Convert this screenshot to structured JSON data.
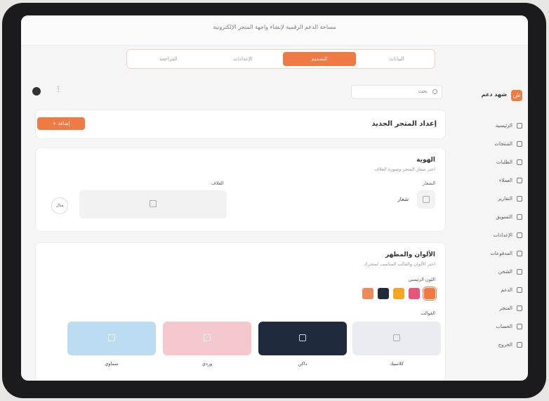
{
  "banner": {
    "text": "مساحة الدعم الرقمية لإنشاء واجهة المتجر الإلكترونية"
  },
  "steps": [
    {
      "label": "البيانات"
    },
    {
      "label": "التصميم"
    },
    {
      "label": "الإعدادات"
    },
    {
      "label": "المراجعة"
    }
  ],
  "sidebar": {
    "brand": "شهد دعم",
    "brand_icon": "ش",
    "items": [
      {
        "label": "الرئيسية",
        "icon": "home-icon"
      },
      {
        "label": "المنتجات",
        "icon": "box-icon"
      },
      {
        "label": "الطلبات",
        "icon": "cart-icon"
      },
      {
        "label": "العملاء",
        "icon": "users-icon"
      },
      {
        "label": "التقارير",
        "icon": "chart-icon"
      },
      {
        "label": "التسويق",
        "icon": "megaphone-icon"
      },
      {
        "label": "الإعدادات",
        "icon": "gear-icon"
      },
      {
        "label": "المدفوعات",
        "icon": "card-icon"
      },
      {
        "label": "الشحن",
        "icon": "truck-icon"
      },
      {
        "label": "الدعم",
        "icon": "help-icon"
      },
      {
        "label": "المتجر",
        "icon": "store-icon"
      },
      {
        "label": "الحساب",
        "icon": "user-icon"
      },
      {
        "label": "الخروج",
        "icon": "logout-icon"
      }
    ]
  },
  "topbar": {
    "search_label": "بحث",
    "more": "⋮"
  },
  "header_card": {
    "title": "إعداد المتجر الجديد",
    "button": "+ إضافة"
  },
  "identity": {
    "title": "الهوية",
    "subtitle": "اختر شعار المتجر وصورة الغلاف",
    "logo_label": "الشعار",
    "logo_name": "شعار",
    "cover_label": "الغلاف",
    "example": "مثال"
  },
  "colors": {
    "title": "الألوان والمظهر",
    "subtitle": "اختر الألوان والقالب المناسب لمتجرك",
    "palette_label": "اللون الرئيسي",
    "swatches": [
      "#f07a43",
      "#e8547a",
      "#f4a623",
      "#1f2b3d",
      "#e88c5c"
    ],
    "themes_label": "القوالب",
    "themes": [
      {
        "name": "كلاسيك",
        "color": "#e9edf2"
      },
      {
        "name": "داكن",
        "color": "#1f2b3d"
      },
      {
        "name": "وردي",
        "color": "#f5c8cf"
      },
      {
        "name": "سماوي",
        "color": "#bcdcf1"
      }
    ]
  }
}
